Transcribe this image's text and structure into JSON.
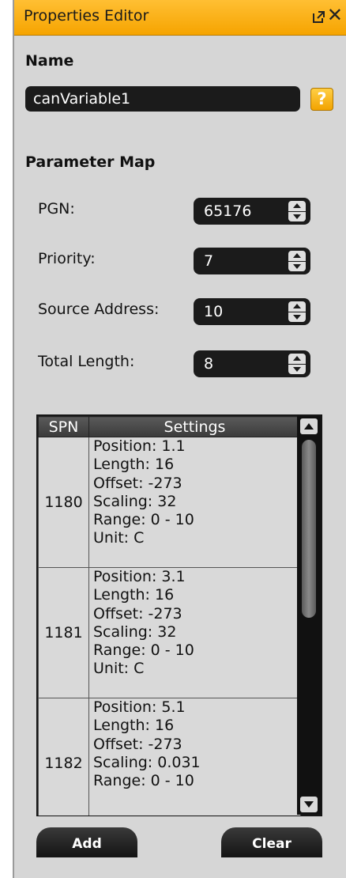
{
  "window": {
    "title": "Properties Editor"
  },
  "name_section": {
    "label": "Name",
    "value": "canVariable1",
    "help": "?"
  },
  "parameter_map": {
    "label": "Parameter Map",
    "fields": [
      {
        "label": "PGN:",
        "value": "65176"
      },
      {
        "label": "Priority:",
        "value": "7"
      },
      {
        "label": "Source Address:",
        "value": "10"
      },
      {
        "label": "Total Length:",
        "value": "8"
      }
    ]
  },
  "table": {
    "columns": [
      "SPN",
      "Settings"
    ],
    "rows": [
      {
        "spn": "1180",
        "settings": [
          "Position: 1.1",
          "Length: 16",
          "Offset: -273",
          "Scaling: 32",
          "Range: 0 - 10",
          "Unit: C"
        ]
      },
      {
        "spn": "1181",
        "settings": [
          "Position: 3.1",
          "Length: 16",
          "Offset: -273",
          "Scaling: 32",
          "Range: 0 - 10",
          "Unit: C"
        ]
      },
      {
        "spn": "1182",
        "settings": [
          "Position: 5.1",
          "Length: 16",
          "Offset: -273",
          "Scaling: 0.031",
          "Range: 0 - 10"
        ]
      }
    ]
  },
  "buttons": {
    "add": "Add",
    "clear": "Clear"
  },
  "colors": {
    "titlebar": "#f6a400",
    "panel": "#d6d6d6",
    "field_bg": "#1b1b1b"
  }
}
